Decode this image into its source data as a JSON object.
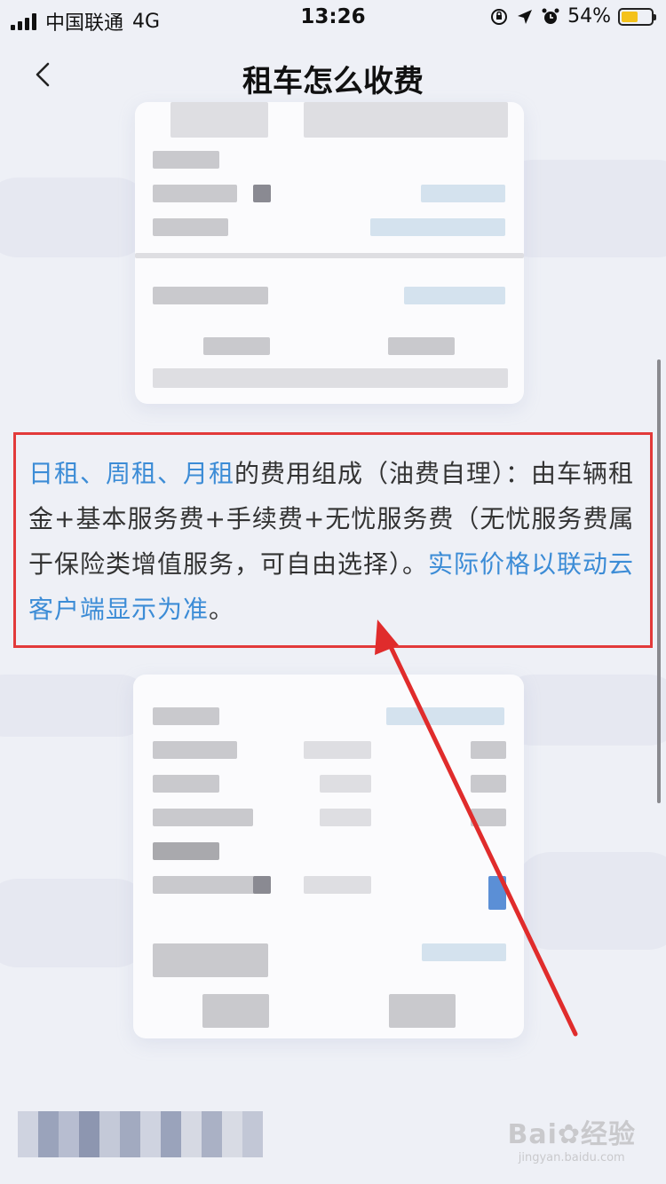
{
  "status_bar": {
    "carrier": "中国联通",
    "network": "4G",
    "time": "13:26",
    "battery": "54%"
  },
  "nav": {
    "title": "租车怎么收费",
    "back_icon": "chevron-left-icon"
  },
  "content": {
    "part1": "日租、周租、月租",
    "part2": "的费用组成（油费自理）：由车辆租金+基本服务费+手续费+无忧服务费（无忧服务费属于保险类增值服务，可自由选择）。",
    "part3": "实际价格以联动云客户端显示为准",
    "part4": "。"
  },
  "colors": {
    "link_blue": "#3c8cd6",
    "highlight_red": "#e23a3a"
  },
  "watermark": {
    "main": "Bai✿经验",
    "sub": "jingyan.baidu.com"
  }
}
